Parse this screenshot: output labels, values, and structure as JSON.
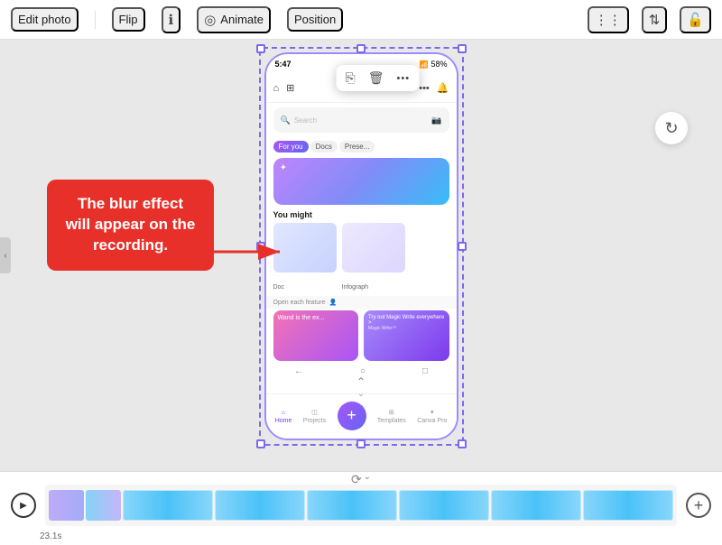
{
  "toolbar": {
    "edit_photo_label": "Edit photo",
    "flip_label": "Flip",
    "animate_label": "Animate",
    "position_label": "Position",
    "info_icon": "ℹ",
    "animate_icon": "◎",
    "grid_icon": "⋮⋮",
    "align_icon": "⇅",
    "lock_icon": "🔓"
  },
  "canvas": {
    "callout_text": "The blur effect will appear on the recording.",
    "callout_bg": "#e8302a",
    "phone_frame_border": "#9b8cff",
    "refresh_icon": "↻"
  },
  "float_toolbar": {
    "copy_icon": "⎘",
    "delete_icon": "🗑",
    "more_icon": "•••"
  },
  "phone_content": {
    "status_time": "5:47",
    "status_battery": "58%",
    "section_you_might": "You might ",
    "section_open_each": "Open each",
    "section_feature": "feature",
    "doc_label": "Doc",
    "infograph_label": "Infograph",
    "magic_card1": "Wand is the ex...",
    "magic_card2": "Try out Magic Write everywhere >",
    "magic_write_label": "Magic Write™",
    "nav_home": "Home",
    "nav_projects": "Projects",
    "nav_templates": "Templates",
    "nav_canvapro": "Canva Pro"
  },
  "playback": {
    "play_icon": "▶",
    "timestamp": "23.1s",
    "add_icon": "+",
    "sync_icon": "⟳"
  }
}
